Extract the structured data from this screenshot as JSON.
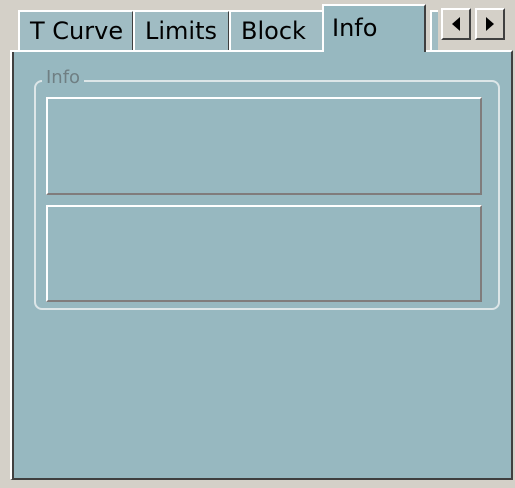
{
  "tabs": [
    {
      "label": "T Curve",
      "active": false
    },
    {
      "label": "Limits",
      "active": false
    },
    {
      "label": "Block",
      "active": false
    },
    {
      "label": "Info",
      "active": true
    },
    {
      "label": "",
      "active": false,
      "partial": true
    }
  ],
  "tab_scroll": {
    "left_icon": "triangle-left-icon",
    "right_icon": "triangle-right-icon"
  },
  "info_group": {
    "title": "Info",
    "fields": [
      {
        "value": ""
      },
      {
        "value": ""
      }
    ]
  },
  "colors": {
    "panel_bg": "#97b8c0",
    "tab_bg": "#a0bcc3",
    "chrome_bg": "#d4d0c8"
  }
}
